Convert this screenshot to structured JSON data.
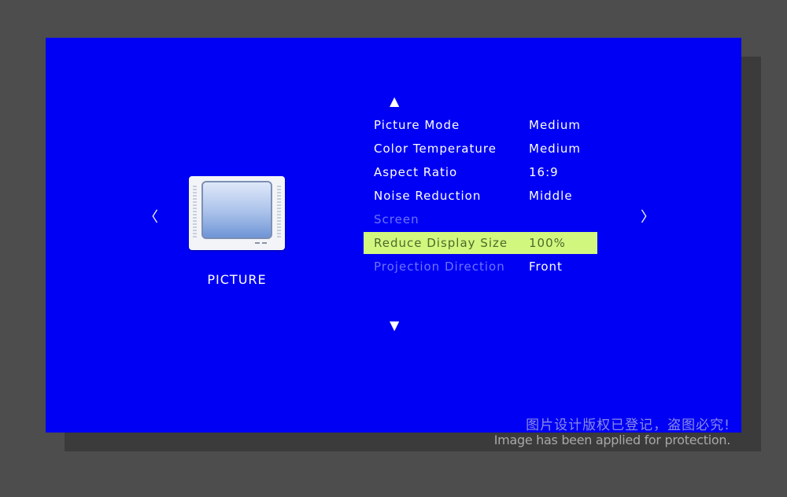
{
  "nav": {
    "left_glyph": "〈",
    "right_glyph": "〉",
    "up_glyph": "▲",
    "down_glyph": "▼"
  },
  "category": {
    "icon": "tv-icon",
    "label": "PICTURE"
  },
  "menu": {
    "items": [
      {
        "label": "Picture Mode",
        "value": "Medium",
        "state": "normal"
      },
      {
        "label": "Color Temperature",
        "value": "Medium",
        "state": "normal"
      },
      {
        "label": "Aspect Ratio",
        "value": "16:9",
        "state": "normal"
      },
      {
        "label": "Noise Reduction",
        "value": "Middle",
        "state": "normal"
      },
      {
        "label": "Screen",
        "value": "",
        "state": "disabled"
      },
      {
        "label": "Reduce Display Size",
        "value": "100%",
        "state": "selected"
      },
      {
        "label": "Projection Direction",
        "value": "Front",
        "state": "disabled-label"
      }
    ]
  },
  "colors": {
    "screen_bg": "#0000f5",
    "highlight": "#d2f77f",
    "disabled_text": "#6e73ff"
  },
  "watermark": {
    "line1": "图片设计版权已登记，盗图必究!",
    "line2": "Image has been applied for protection."
  }
}
